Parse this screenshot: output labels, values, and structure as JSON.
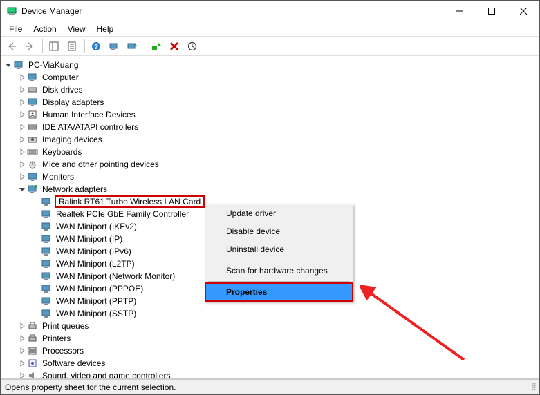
{
  "window": {
    "title": "Device Manager"
  },
  "menubar": {
    "items": [
      "File",
      "Action",
      "View",
      "Help"
    ]
  },
  "tree": {
    "root": "PC-ViaKuang",
    "categories": [
      {
        "label": "Computer",
        "expanded": false
      },
      {
        "label": "Disk drives",
        "expanded": false
      },
      {
        "label": "Display adapters",
        "expanded": false
      },
      {
        "label": "Human Interface Devices",
        "expanded": false
      },
      {
        "label": "IDE ATA/ATAPI controllers",
        "expanded": false
      },
      {
        "label": "Imaging devices",
        "expanded": false
      },
      {
        "label": "Keyboards",
        "expanded": false
      },
      {
        "label": "Mice and other pointing devices",
        "expanded": false
      },
      {
        "label": "Monitors",
        "expanded": false
      },
      {
        "label": "Network adapters",
        "expanded": true,
        "children": [
          "Ralink RT61 Turbo Wireless LAN Card",
          "Realtek PCIe GbE Family Controller",
          "WAN Miniport (IKEv2)",
          "WAN Miniport (IP)",
          "WAN Miniport (IPv6)",
          "WAN Miniport (L2TP)",
          "WAN Miniport (Network Monitor)",
          "WAN Miniport (PPPOE)",
          "WAN Miniport (PPTP)",
          "WAN Miniport (SSTP)"
        ],
        "selected_index": 0
      },
      {
        "label": "Print queues",
        "expanded": false
      },
      {
        "label": "Printers",
        "expanded": false
      },
      {
        "label": "Processors",
        "expanded": false
      },
      {
        "label": "Software devices",
        "expanded": false
      },
      {
        "label": "Sound, video and game controllers",
        "expanded": false
      }
    ]
  },
  "context_menu": {
    "items": [
      {
        "label": "Update driver"
      },
      {
        "label": "Disable device"
      },
      {
        "label": "Uninstall device"
      },
      {
        "sep": true
      },
      {
        "label": "Scan for hardware changes"
      },
      {
        "sep": true
      },
      {
        "label": "Properties",
        "highlight": true
      }
    ]
  },
  "statusbar": {
    "text": "Opens property sheet for the current selection."
  }
}
